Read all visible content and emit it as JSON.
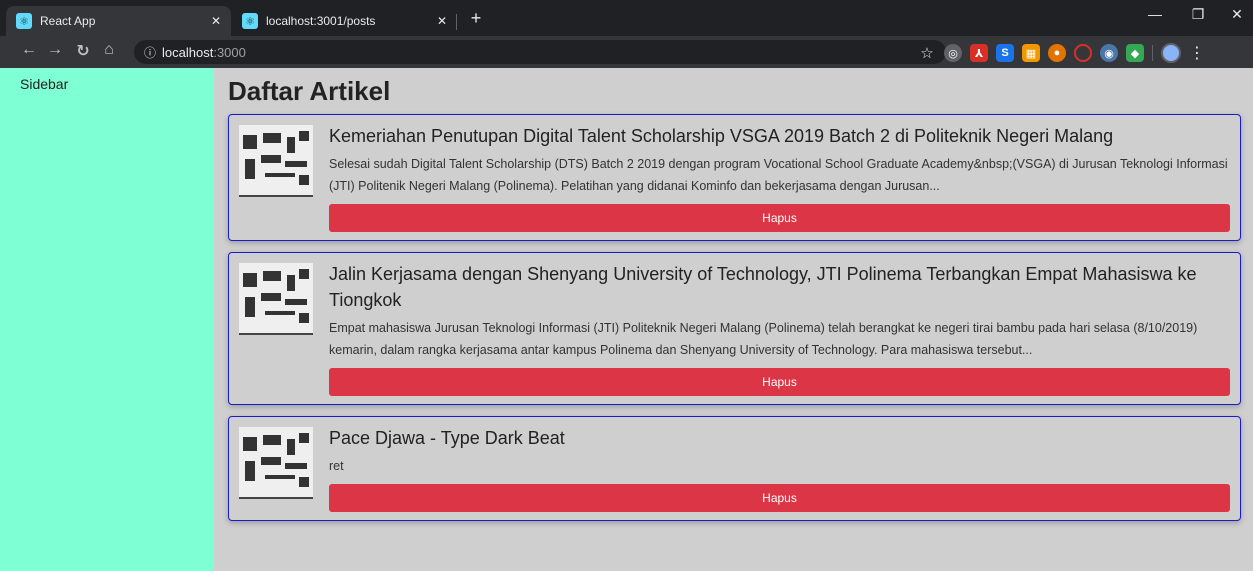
{
  "browser": {
    "tabs": [
      {
        "title": "React App",
        "active": true
      },
      {
        "title": "localhost:3001/posts",
        "active": false
      }
    ],
    "address": {
      "host": "localhost",
      "port": ":3000"
    },
    "colors": {
      "chrome_dark": "#202124",
      "toolbar": "#35363a"
    }
  },
  "sidebar": {
    "label": "Sidebar",
    "color": "#7fffd4"
  },
  "main": {
    "title": "Daftar Artikel",
    "delete_label": "Hapus",
    "articles": [
      {
        "title": "Kemeriahan Penutupan Digital Talent Scholarship VSGA 2019 Batch 2 di Politeknik Negeri Malang",
        "excerpt": "Selesai sudah Digital Talent Scholarship (DTS) Batch 2 2019 dengan program Vocational School Graduate Academy&nbsp;(VSGA) di Jurusan Teknologi Informasi (JTI) Politenik Negeri Malang (Polinema). Pelatihan yang didanai Kominfo dan bekerjasama dengan Jurusan..."
      },
      {
        "title": "Jalin Kerjasama dengan Shenyang University of Technology, JTI Polinema Terbangkan Empat Mahasiswa ke Tiongkok",
        "excerpt": "Empat mahasiswa Jurusan Teknologi Informasi (JTI) Politeknik Negeri Malang (Polinema) telah berangkat ke negeri tirai bambu pada hari selasa (8/10/2019) kemarin, dalam rangka kerjasama antar kampus Polinema dan Shenyang University of Technology. Para mahasiswa tersebut..."
      },
      {
        "title": "Pace Djawa - Type Dark Beat",
        "excerpt": "ret"
      }
    ],
    "colors": {
      "card_border": "#1a1ad0",
      "delete_button": "#dc3545",
      "background": "#cfcfcf"
    }
  }
}
